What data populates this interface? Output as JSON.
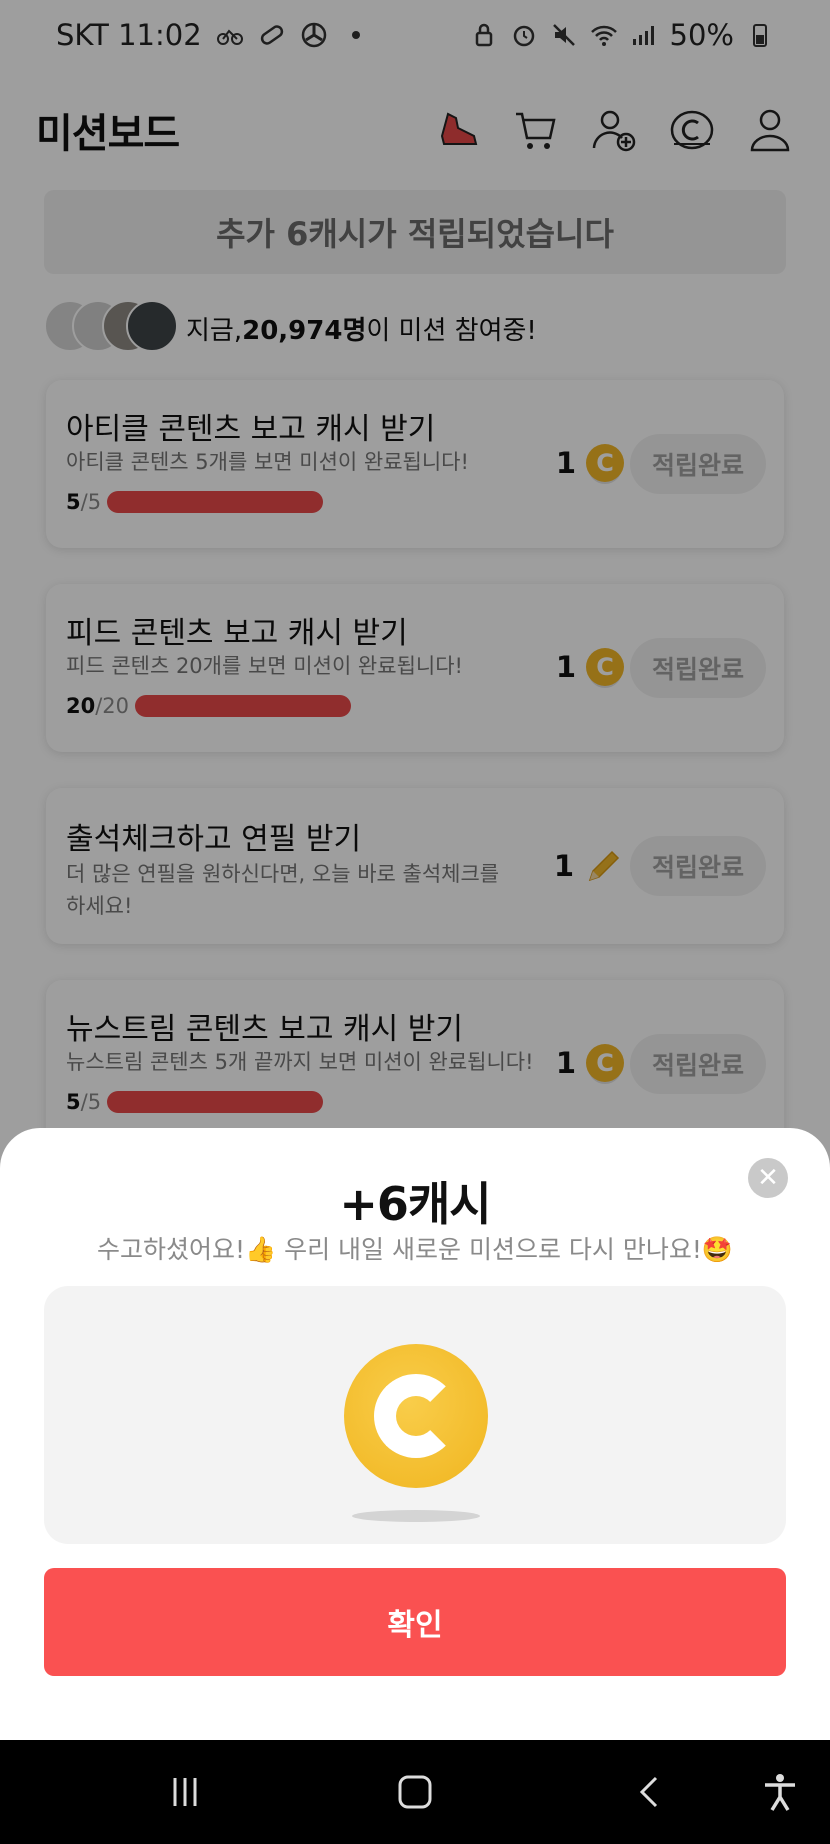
{
  "status_bar": {
    "carrier_time": "SKT 11:02",
    "battery": "50%",
    "icons": [
      "bike-icon",
      "pill-icon",
      "fan-icon",
      "dot-icon",
      "lock-icon",
      "alarm-icon",
      "mute-icon",
      "wifi-icon",
      "signal-icon",
      "battery-icon"
    ]
  },
  "header": {
    "title": "미션보드",
    "icons": [
      "shoe-icon",
      "cart-icon",
      "add-user-icon",
      "coin-icon",
      "profile-icon"
    ]
  },
  "banner": {
    "text": "추가 6캐시가 적립되었습니다"
  },
  "participants": {
    "prefix": "지금, ",
    "count": "20,974명",
    "suffix": "이 미션 참여중!"
  },
  "missions": [
    {
      "title": "아티클 콘텐츠 보고 캐시 받기",
      "desc": "아티클 콘텐츠 5개를 보면 미션이 완료됩니다!",
      "done": "5",
      "total": "/5",
      "progress": 1.0,
      "reward": "1",
      "reward_icon": "coin-icon",
      "button": "적립완료"
    },
    {
      "title": "피드 콘텐츠 보고 캐시 받기",
      "desc": "피드 콘텐츠 20개를 보면 미션이 완료됩니다!",
      "done": "20",
      "total": "/20",
      "progress": 1.0,
      "reward": "1",
      "reward_icon": "coin-icon",
      "button": "적립완료"
    },
    {
      "title": "출석체크하고 연필 받기",
      "desc": "더 많은 연필을 원하신다면, 오늘 바로 출석체크를 하세요!",
      "reward": "1",
      "reward_icon": "pencil-icon",
      "button": "적립완료"
    },
    {
      "title": "뉴스트림 콘텐츠 보고 캐시 받기",
      "desc": "뉴스트림 콘텐츠 5개 끝까지 보면 미션이 완료됩니다!",
      "done": "5",
      "total": "/5",
      "progress": 1.0,
      "reward": "1",
      "reward_icon": "coin-icon",
      "button": "적립완료"
    }
  ],
  "sheet": {
    "amount": "+6캐시",
    "message": "수고하셨어요!👍 우리 내일 새로운 미션으로 다시 만나요!🤩",
    "confirm": "확인",
    "close_icon": "close-icon",
    "coin_icon": "coin-icon"
  },
  "navbar": {
    "icons": [
      "recent-apps-icon",
      "home-icon",
      "back-icon",
      "accessibility-icon"
    ]
  }
}
